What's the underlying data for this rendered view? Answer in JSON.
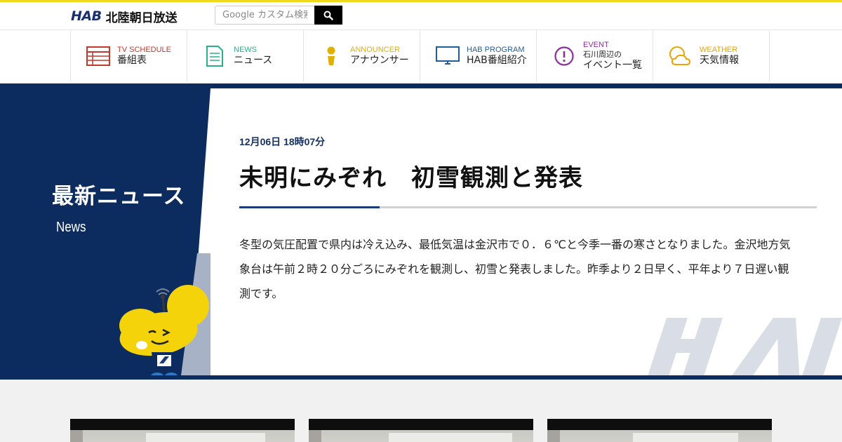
{
  "header": {
    "logo_mark": "HAB",
    "logo_name": "北陸朝日放送",
    "search_placeholder": "Google カスタム検索"
  },
  "nav": [
    {
      "en": "TV SCHEDULE",
      "ja": "番組表",
      "color": "#c0392b",
      "icon": "tv-schedule-icon"
    },
    {
      "en": "NEWS",
      "ja": "ニュース",
      "color": "#2bae8a",
      "icon": "news-icon"
    },
    {
      "en": "ANNOUNCER",
      "ja": "アナウンサー",
      "color": "#e0b000",
      "icon": "announcer-icon"
    },
    {
      "en": "HAB PROGRAM",
      "ja": "HAB番組紹介",
      "color": "#1f5e9e",
      "icon": "monitor-icon"
    },
    {
      "en": "EVENT",
      "ja1": "石川周辺の",
      "ja2": "イベント一覧",
      "color": "#8e2e9e",
      "icon": "alert-icon"
    },
    {
      "en": "WEATHER",
      "ja": "天気情報",
      "color": "#e8a400",
      "icon": "weather-icon"
    }
  ],
  "section": {
    "title": "最新ニュース",
    "subtitle": "News"
  },
  "article": {
    "date": "12月06日 18時07分",
    "headline": "未明にみぞれ　初雪観測と発表",
    "body": "冬型の気圧配置で県内は冷え込み、最低気温は金沢市で０．６℃と今季一番の寒さとなりました。金沢地方気象台は午前２時２０分ごろにみぞれを観測し、初雪と発表しました。昨季より２日早く、平年より７日遅い観測です。"
  },
  "watermark": "HAB",
  "colors": {
    "navy": "#0c2c60",
    "accent_yellow": "#f2d91c",
    "lower_bg": "#f1f1f1"
  }
}
